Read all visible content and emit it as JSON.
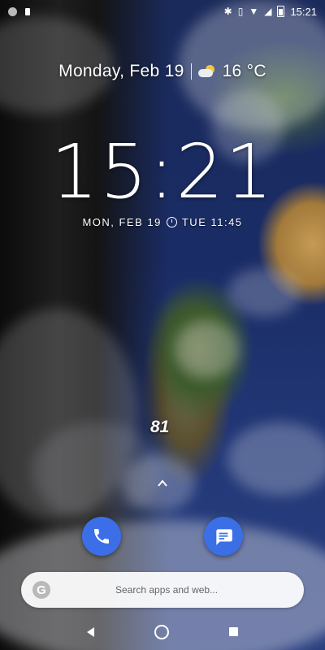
{
  "status_bar": {
    "time": "15:21",
    "left_icons": [
      "notification-dot-icon",
      "lock-icon"
    ],
    "right_icons": [
      "bluetooth-icon",
      "vibrate-icon",
      "wifi-icon",
      "signal-icon",
      "battery-icon"
    ]
  },
  "lockscreen": {
    "date": "Monday, Feb 19",
    "temperature": "16 °C",
    "weather_icon": "partly-cloudy-icon",
    "clock": "15:21",
    "alarm_date": "MON, FEB 19",
    "alarm_next": "TUE 11:45"
  },
  "widget": {
    "number": "81"
  },
  "dock": {
    "apps": [
      {
        "name": "Phone",
        "icon": "phone-icon",
        "color": "#3c6ee8"
      },
      {
        "name": "Messages",
        "icon": "messages-icon",
        "color": "#3b6fe6"
      }
    ]
  },
  "search": {
    "placeholder": "Search apps and web..."
  },
  "nav": {
    "buttons": [
      "back",
      "home",
      "recents"
    ]
  }
}
